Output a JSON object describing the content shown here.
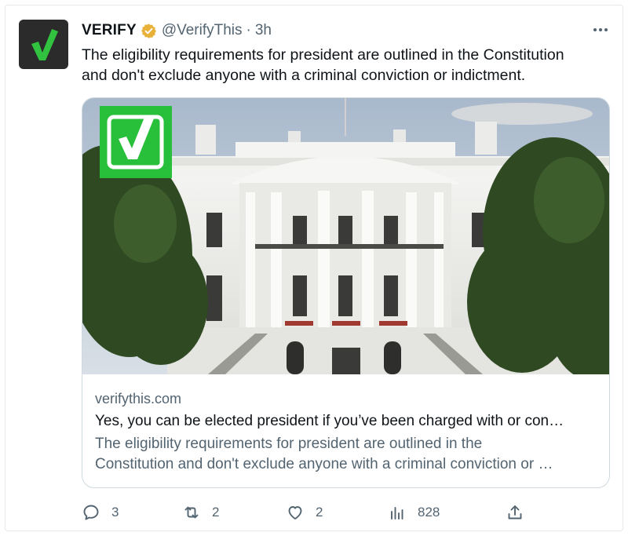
{
  "tweet": {
    "author_name": "VERIFY",
    "handle": "@VerifyThis",
    "separator": "·",
    "time": "3h",
    "text": "The eligibility requirements for president are outlined in the Constitution and don't exclude anyone with a criminal conviction or indictment.",
    "text_lines": [
      "The eligibility requirements for president are outlined in the Constitution",
      "and don't exclude anyone with a criminal conviction or indictment."
    ]
  },
  "card": {
    "domain": "verifythis.com",
    "title": "Yes, you can be elected president if you’ve been charged with or con…",
    "description_lines": [
      "The eligibility requirements for president are outlined in the",
      "Constitution and don't exclude anyone with a criminal conviction or …"
    ],
    "image_subject": "white-house-photo",
    "brand_color": "#28c03a"
  },
  "actions": {
    "reply_count": "3",
    "repost_count": "2",
    "like_count": "2",
    "views_count": "828"
  },
  "colors": {
    "text": "#0f1419",
    "secondary": "#536471",
    "verified_badge": "#e8b23a",
    "border": "#cfd9de"
  }
}
